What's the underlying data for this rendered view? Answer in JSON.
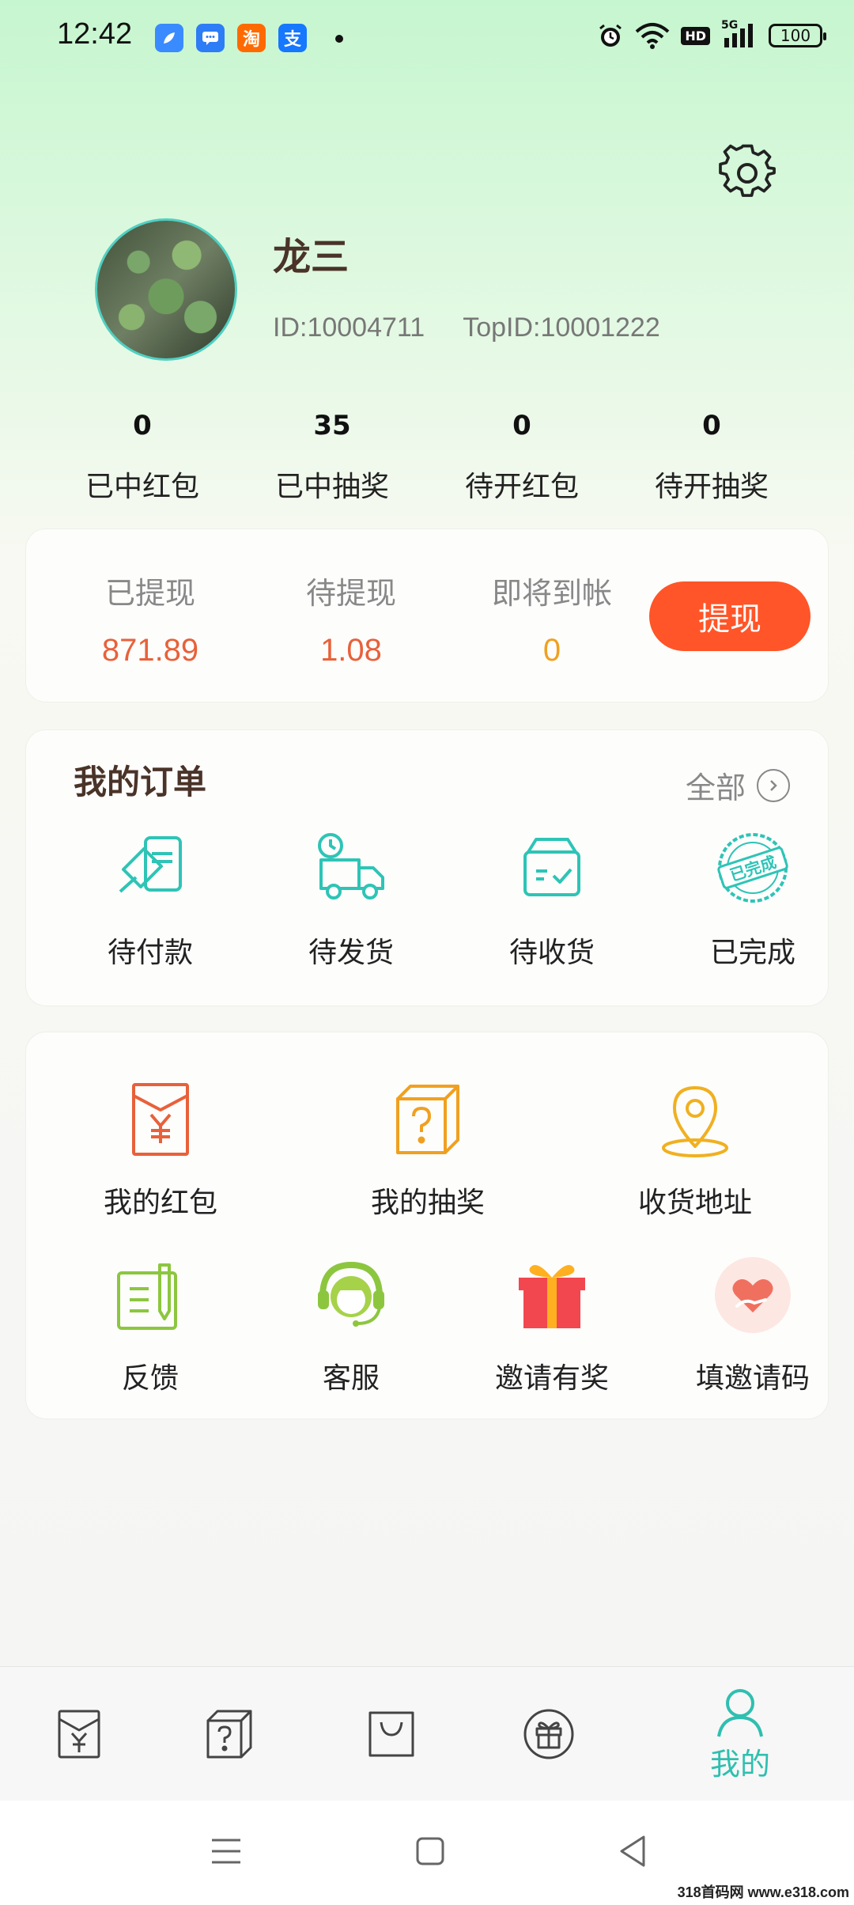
{
  "status_bar": {
    "time": "12:42",
    "battery": "100",
    "network": "5G",
    "hd": "HD",
    "notif_apps": [
      {
        "name": "browser",
        "glyph": "",
        "color": "#3a8bff"
      },
      {
        "name": "messages",
        "glyph": "",
        "color": "#2d7df6"
      },
      {
        "name": "taobao",
        "glyph": "淘",
        "color": "#ff6a00"
      },
      {
        "name": "alipay",
        "glyph": "支",
        "color": "#1677ff"
      }
    ]
  },
  "profile": {
    "name": "龙三",
    "id_text": "ID:10004711",
    "top_id_text": "TopID:10001222"
  },
  "stats": [
    {
      "value": "0",
      "label": "已中红包"
    },
    {
      "value": "35",
      "label": "已中抽奖"
    },
    {
      "value": "0",
      "label": "待开红包"
    },
    {
      "value": "0",
      "label": "待开抽奖"
    }
  ],
  "wallet": {
    "items": [
      {
        "label": "已提现",
        "value": "871.89",
        "color": "#e8613a"
      },
      {
        "label": "待提现",
        "value": "1.08",
        "color": "#e8613a"
      },
      {
        "label": "即将到帐",
        "value": "0",
        "color": "#f0a020"
      }
    ],
    "withdraw_label": "提现",
    "withdraw_color": "#ff5528"
  },
  "orders": {
    "title": "我的订单",
    "all_label": "全部",
    "items": [
      {
        "label": "待付款",
        "icon": "payment-icon"
      },
      {
        "label": "待发货",
        "icon": "delivery-truck-icon"
      },
      {
        "label": "待收货",
        "icon": "receive-box-icon"
      },
      {
        "label": "已完成",
        "icon": "completed-stamp-icon",
        "stamp_text": "已完成"
      }
    ]
  },
  "services": {
    "row1": [
      {
        "label": "我的红包",
        "icon": "red-envelope-icon"
      },
      {
        "label": "我的抽奖",
        "icon": "lottery-box-icon"
      },
      {
        "label": "收货地址",
        "icon": "location-pin-icon"
      }
    ],
    "row2": [
      {
        "label": "反馈",
        "icon": "feedback-icon"
      },
      {
        "label": "客服",
        "icon": "customer-service-icon"
      },
      {
        "label": "邀请有奖",
        "icon": "gift-icon"
      },
      {
        "label": "填邀请码",
        "icon": "heart-hand-icon"
      }
    ]
  },
  "bottom_nav": {
    "items": [
      {
        "icon": "red-envelope-icon",
        "label": ""
      },
      {
        "icon": "lottery-box-icon",
        "label": ""
      },
      {
        "icon": "shopping-bag-icon",
        "label": ""
      },
      {
        "icon": "gift-icon",
        "label": ""
      },
      {
        "icon": "user-icon",
        "label": "我的",
        "active": true
      }
    ],
    "accent": "#2fbfb0"
  },
  "watermark": "318首码网 www.e318.com"
}
